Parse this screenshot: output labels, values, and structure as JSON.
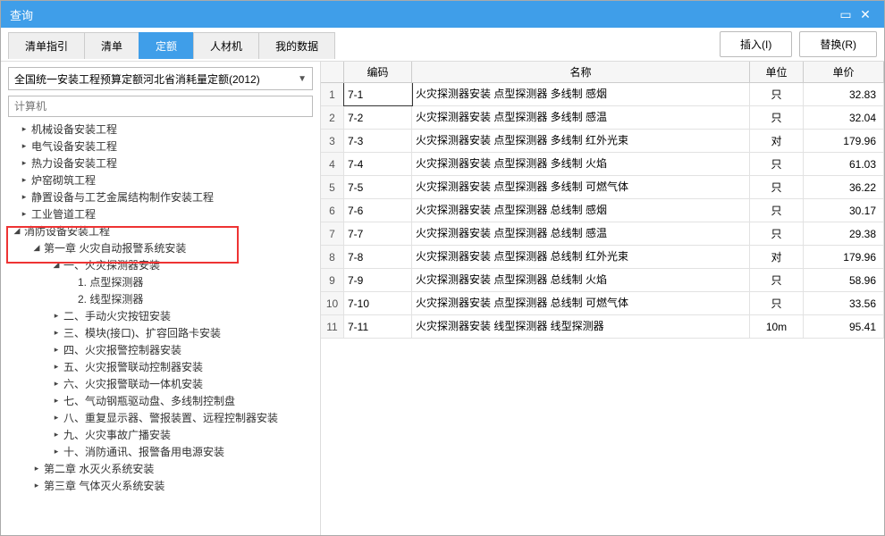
{
  "window": {
    "title": "查询"
  },
  "toolbar": {
    "tabs": [
      "清单指引",
      "清单",
      "定额",
      "人材机",
      "我的数据"
    ],
    "active_tab": 2,
    "insert_btn": "插入(I)",
    "replace_btn": "替换(R)"
  },
  "left": {
    "dropdown_value": "全国统一安装工程预算定额河北省消耗量定额(2012)",
    "filter_placeholder": "计算机",
    "tree_level1": [
      "机械设备安装工程",
      "电气设备安装工程",
      "热力设备安装工程",
      "炉窑砌筑工程",
      "静置设备与工艺金属结构制作安装工程",
      "工业管道工程"
    ],
    "tree_fire_root": "消防设备安装工程",
    "tree_ch1": "第一章 火灾自动报警系统安装",
    "tree_sec1": "一、火灾探测器安装",
    "tree_sec1_items": [
      "1. 点型探测器",
      "2. 线型探测器"
    ],
    "tree_other_sections": [
      "二、手动火灾按钮安装",
      "三、模块(接口)、扩容回路卡安装",
      "四、火灾报警控制器安装",
      "五、火灾报警联动控制器安装",
      "六、火灾报警联动一体机安装",
      "七、气动钢瓶驱动盘、多线制控制盘",
      "八、重复显示器、警报装置、远程控制器安装",
      "九、火灾事故广播安装",
      "十、消防通讯、报警备用电源安装"
    ],
    "tree_ch2": "第二章 水灭火系统安装",
    "tree_ch3": "第三章 气体灭火系统安装"
  },
  "grid": {
    "headers": {
      "row": "",
      "code": "编码",
      "name": "名称",
      "unit": "单位",
      "price": "单价"
    },
    "rows": [
      {
        "n": "1",
        "code": "7-1",
        "name": "火灾探测器安装 点型探测器 多线制 感烟",
        "unit": "只",
        "price": "32.83"
      },
      {
        "n": "2",
        "code": "7-2",
        "name": "火灾探测器安装 点型探测器 多线制 感温",
        "unit": "只",
        "price": "32.04"
      },
      {
        "n": "3",
        "code": "7-3",
        "name": "火灾探测器安装 点型探测器 多线制 红外光束",
        "unit": "对",
        "price": "179.96"
      },
      {
        "n": "4",
        "code": "7-4",
        "name": "火灾探测器安装 点型探测器 多线制 火焰",
        "unit": "只",
        "price": "61.03"
      },
      {
        "n": "5",
        "code": "7-5",
        "name": "火灾探测器安装 点型探测器 多线制 可燃气体",
        "unit": "只",
        "price": "36.22"
      },
      {
        "n": "6",
        "code": "7-6",
        "name": "火灾探测器安装 点型探测器 总线制 感烟",
        "unit": "只",
        "price": "30.17"
      },
      {
        "n": "7",
        "code": "7-7",
        "name": "火灾探测器安装 点型探测器 总线制 感温",
        "unit": "只",
        "price": "29.38"
      },
      {
        "n": "8",
        "code": "7-8",
        "name": "火灾探测器安装 点型探测器 总线制 红外光束",
        "unit": "对",
        "price": "179.96"
      },
      {
        "n": "9",
        "code": "7-9",
        "name": "火灾探测器安装 点型探测器 总线制 火焰",
        "unit": "只",
        "price": "58.96"
      },
      {
        "n": "10",
        "code": "7-10",
        "name": "火灾探测器安装 点型探测器 总线制 可燃气体",
        "unit": "只",
        "price": "33.56"
      },
      {
        "n": "11",
        "code": "7-11",
        "name": "火灾探测器安装 线型探测器 线型探测器",
        "unit": "10m",
        "price": "95.41"
      }
    ]
  }
}
